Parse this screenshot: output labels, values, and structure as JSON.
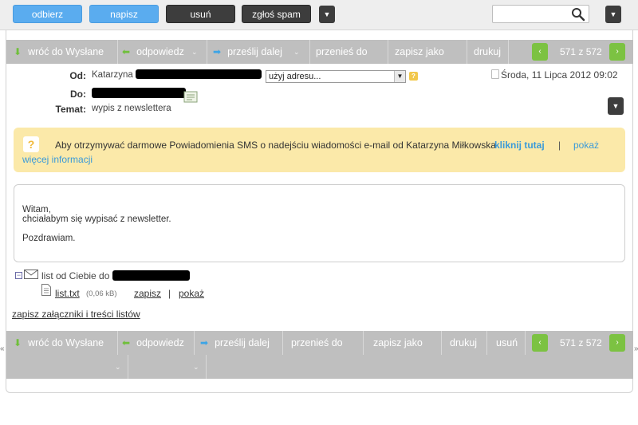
{
  "toolbar": {
    "receive_label": "odbierz",
    "compose_label": "napisz",
    "delete_label": "usuń",
    "spam_label": "zgłoś spam",
    "more_icon": "chevron-down-icon",
    "search_value": "",
    "search_icon": "search-icon"
  },
  "actions_top": {
    "back_label": "wróć do Wysłane",
    "reply_label": "odpowiedz",
    "forward_label": "prześlij dalej",
    "move_label": "przenieś do",
    "save_as_label": "zapisz jako",
    "print_label": "drukuj",
    "counter": "571 z 572"
  },
  "header": {
    "from_label": "Od:",
    "from_name": "Katarzyna",
    "use_address_value": "użyj adresu...",
    "to_label": "Do:",
    "subject_label": "Temat:",
    "subject_value": "wypis z newslettera",
    "date": "Środa, 11 Lipca 2012 09:02"
  },
  "notice": {
    "icon": "?",
    "text": "Aby otrzymywać darmowe Powiadomienia SMS o nadejściu wiadomości e-mail od Katarzyna Miłkowska",
    "link_bold": "kliknij tutaj",
    "separator": "|",
    "link_more_part1": "pokaż",
    "link_more_part2": "więcej informacji"
  },
  "message": {
    "line1": "Witam,",
    "line2": "chciałabym się wypisać z newsletter.",
    "line3": "Pozdrawiam."
  },
  "attachments": {
    "toggle": "−",
    "from_label": "list od Ciebie do",
    "file_name": "list.txt",
    "file_size": "(0,06 kB)",
    "save_label": "zapisz",
    "separator": "|",
    "show_label": "pokaż",
    "save_all_label": "zapisz załączniki i treści listów"
  },
  "actions_bottom": {
    "back_label": "wróć do Wysłane",
    "reply_label": "odpowiedz",
    "forward_label": "prześlij dalej",
    "move_label": "przenieś do",
    "save_as_label": "zapisz jako",
    "print_label": "drukuj",
    "delete_label": "usuń",
    "counter": "571 z 572"
  },
  "nav": {
    "prev": "‹",
    "next": "›",
    "side_left": "«",
    "side_right": "»"
  },
  "colors": {
    "blue_button": "#5aacef",
    "dark_button": "#3d3d3d",
    "action_bar": "#bfbfbf",
    "nav_green": "#7cc242",
    "notice_bg": "#fbe9a9",
    "link": "#3a9ad9"
  }
}
